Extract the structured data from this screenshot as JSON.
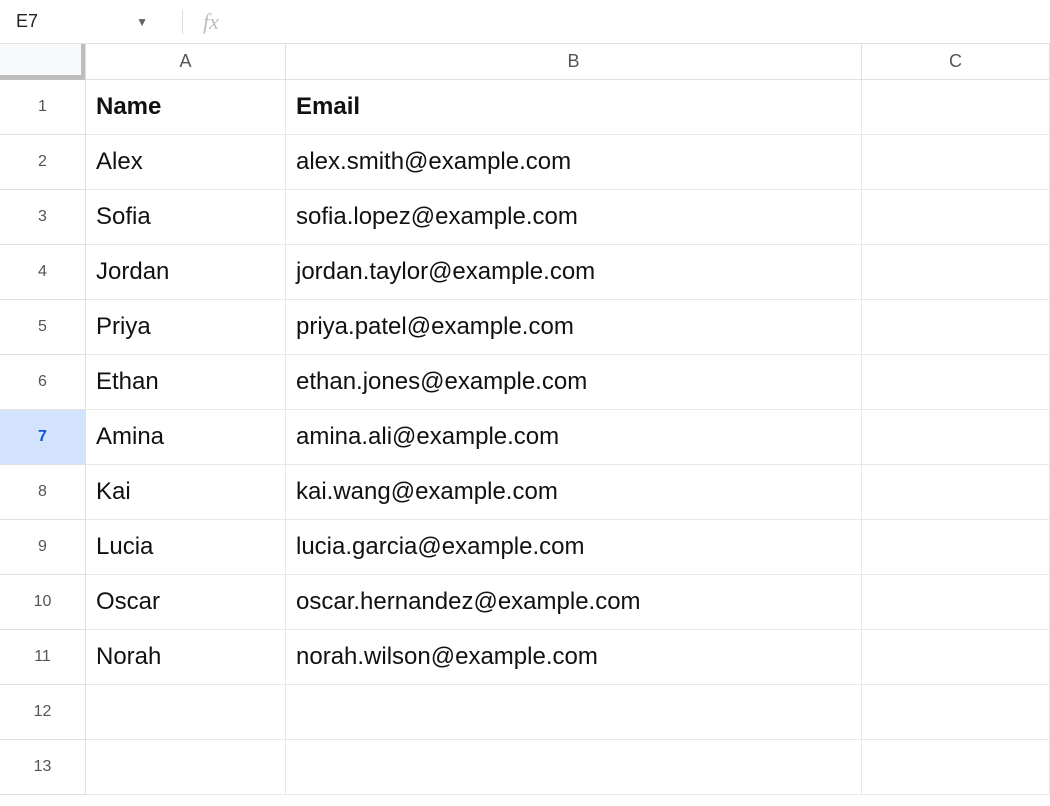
{
  "name_box": "E7",
  "formula_bar": {
    "value": "",
    "placeholder": ""
  },
  "columns": [
    "A",
    "B",
    "C"
  ],
  "selected_row_index": 7,
  "row_count": 13,
  "headers": [
    "Name",
    "Email"
  ],
  "rows": [
    {
      "name": "Alex",
      "email": "alex.smith@example.com"
    },
    {
      "name": "Sofia",
      "email": "sofia.lopez@example.com"
    },
    {
      "name": "Jordan",
      "email": "jordan.taylor@example.com"
    },
    {
      "name": "Priya",
      "email": "priya.patel@example.com"
    },
    {
      "name": "Ethan",
      "email": "ethan.jones@example.com"
    },
    {
      "name": "Amina",
      "email": "amina.ali@example.com"
    },
    {
      "name": "Kai",
      "email": "kai.wang@example.com"
    },
    {
      "name": "Lucia",
      "email": "lucia.garcia@example.com"
    },
    {
      "name": "Oscar",
      "email": "oscar.hernandez@example.com"
    },
    {
      "name": "Norah",
      "email": "norah.wilson@example.com"
    }
  ]
}
